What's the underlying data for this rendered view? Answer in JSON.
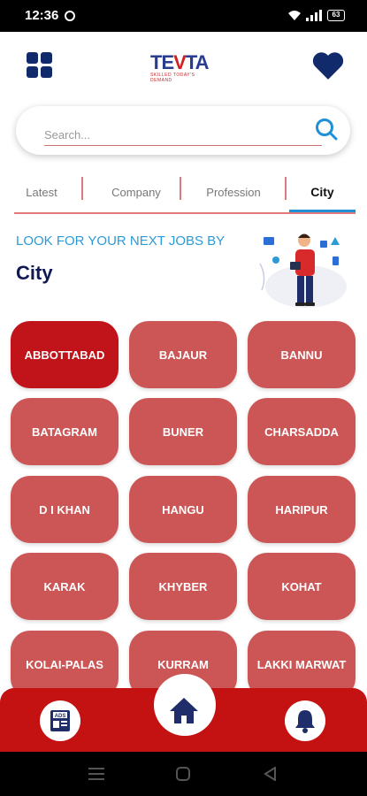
{
  "status_bar": {
    "time": "12:36",
    "battery": "63"
  },
  "header": {
    "logo_text_left": "TE",
    "logo_text_v": "V",
    "logo_text_right": "TA",
    "logo_tagline": "SKILLED TODAY'S DEMAND"
  },
  "search": {
    "placeholder": "Search..."
  },
  "tabs": [
    {
      "label": "Latest"
    },
    {
      "label": "Company"
    },
    {
      "label": "Profession"
    },
    {
      "label": "City"
    }
  ],
  "active_tab": "City",
  "banner": {
    "subtitle": "LOOK FOR YOUR NEXT JOBS BY",
    "title": "City"
  },
  "cities": [
    "ABBOTTABAD",
    "BAJAUR",
    "BANNU",
    "BATAGRAM",
    "BUNER",
    "CHARSADDA",
    "D I KHAN",
    "HANGU",
    "HARIPUR",
    "KARAK",
    "KHYBER",
    "KOHAT",
    "KOLAI-PALAS",
    "KURRAM",
    "LAKKI MARWAT"
  ],
  "selected_city": "ABBOTTABAD",
  "bottom_nav": {
    "ads_label": "ADS"
  },
  "colors": {
    "primary_red": "#c41212",
    "city_button": "#cc5656",
    "city_selected": "#c0131a",
    "navy": "#102a6b",
    "accent_blue": "#2b9ad6"
  }
}
